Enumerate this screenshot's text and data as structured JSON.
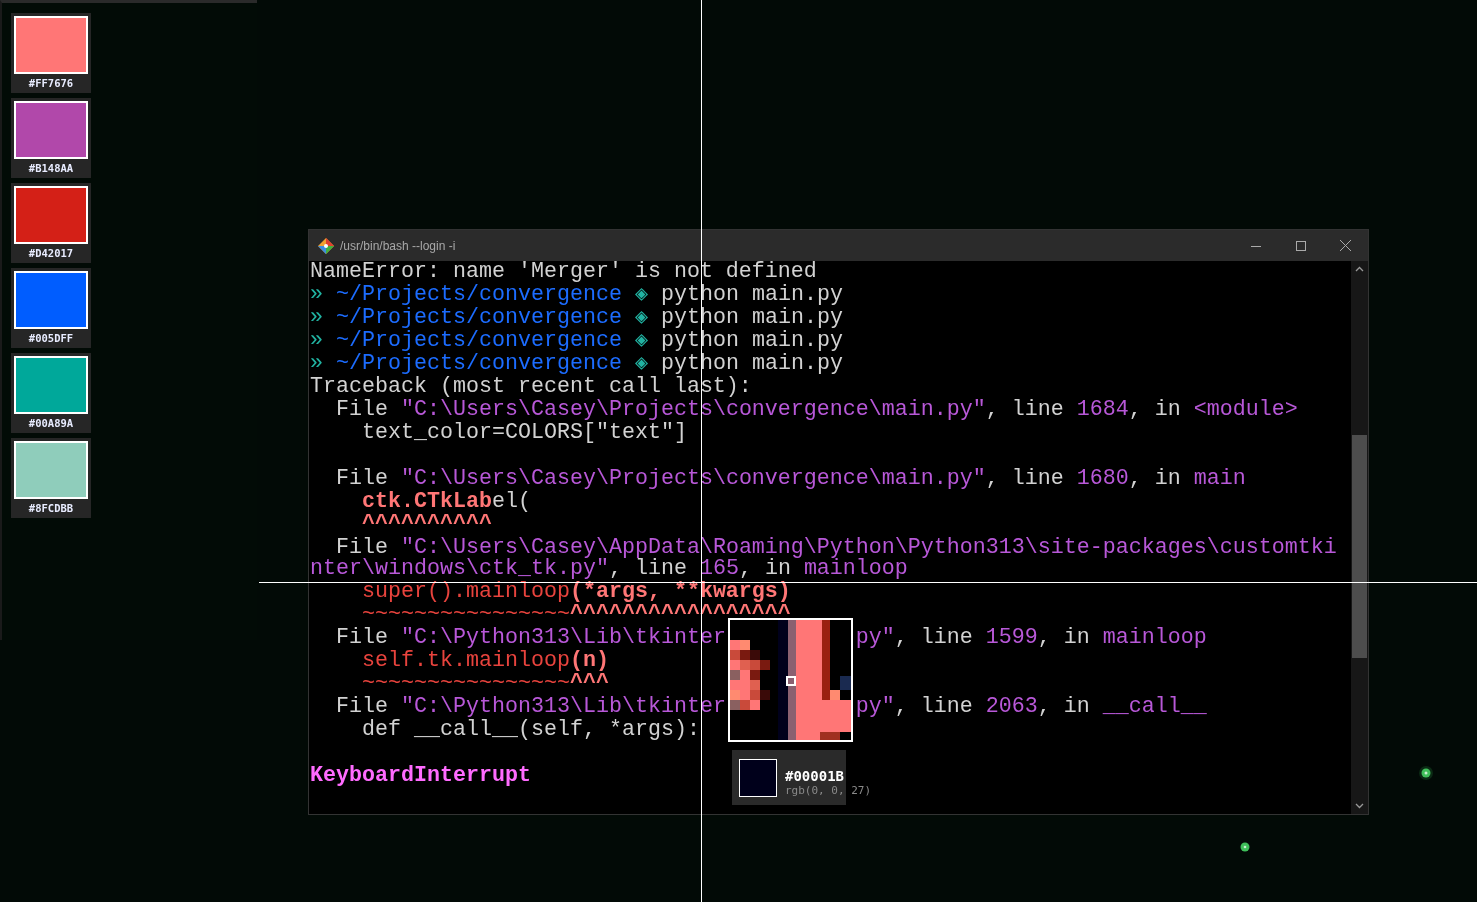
{
  "palette": {
    "swatches": [
      {
        "color": "#ff7676",
        "label": "#FF7676"
      },
      {
        "color": "#b148aa",
        "label": "#B148AA"
      },
      {
        "color": "#d42017",
        "label": "#D42017"
      },
      {
        "color": "#005dff",
        "label": "#005DFF"
      },
      {
        "color": "#00a89a",
        "label": "#00A89A"
      },
      {
        "color": "#8fcdbb",
        "label": "#8FCDBB"
      }
    ]
  },
  "terminal": {
    "title": "/usr/bin/bash --login -i",
    "lines": [
      {
        "kind": "text",
        "segments": [
          {
            "text": "NameError: name 'Merger' is not defined",
            "kind": "plain"
          }
        ]
      },
      {
        "kind": "text",
        "segments": [
          {
            "text": "» ",
            "kind": "prompt"
          },
          {
            "text": "~/Projects/convergence",
            "kind": "path"
          },
          {
            "text": " ◈ ",
            "kind": "prompt"
          },
          {
            "text": "python main.py",
            "kind": "plain"
          }
        ]
      },
      {
        "kind": "text",
        "segments": [
          {
            "text": "» ",
            "kind": "prompt"
          },
          {
            "text": "~/Projects/convergence",
            "kind": "path"
          },
          {
            "text": " ◈ ",
            "kind": "prompt"
          },
          {
            "text": "python main.py",
            "kind": "plain"
          }
        ]
      },
      {
        "kind": "text",
        "segments": [
          {
            "text": "» ",
            "kind": "prompt"
          },
          {
            "text": "~/Projects/convergence",
            "kind": "path"
          },
          {
            "text": " ◈ ",
            "kind": "prompt"
          },
          {
            "text": "python main.py",
            "kind": "plain"
          }
        ]
      },
      {
        "kind": "text",
        "segments": [
          {
            "text": "» ",
            "kind": "prompt"
          },
          {
            "text": "~/Projects/convergence",
            "kind": "path"
          },
          {
            "text": " ◈ ",
            "kind": "prompt"
          },
          {
            "text": "python main.py",
            "kind": "plain"
          }
        ]
      },
      {
        "kind": "text",
        "segments": [
          {
            "text": "Traceback (most recent call last):",
            "kind": "plain"
          }
        ]
      },
      {
        "kind": "text",
        "segments": [
          {
            "text": "  File ",
            "kind": "plain"
          },
          {
            "text": "\"C:\\Users\\Casey\\Projects\\convergence\\main.py\"",
            "kind": "string"
          },
          {
            "text": ", line ",
            "kind": "plain"
          },
          {
            "text": "1684",
            "kind": "string"
          },
          {
            "text": ", in ",
            "kind": "plain"
          },
          {
            "text": "<module>",
            "kind": "string"
          }
        ]
      },
      {
        "kind": "text",
        "segments": [
          {
            "text": "    text_color=COLORS[\"text\"]",
            "kind": "plain"
          }
        ]
      },
      {
        "kind": "blank"
      },
      {
        "kind": "text",
        "segments": [
          {
            "text": "  File ",
            "kind": "plain"
          },
          {
            "text": "\"C:\\Users\\Casey\\Projects\\convergence\\main.py\"",
            "kind": "string"
          },
          {
            "text": ", line ",
            "kind": "plain"
          },
          {
            "text": "1680",
            "kind": "string"
          },
          {
            "text": ", in ",
            "kind": "plain"
          },
          {
            "text": "main",
            "kind": "string"
          }
        ]
      },
      {
        "kind": "text",
        "segments": [
          {
            "text": "    ctk.CTkLab",
            "kind": "strong"
          },
          {
            "text": "el(",
            "kind": "plain"
          }
        ]
      },
      {
        "kind": "text",
        "segments": [
          {
            "text": "    ^^^^^^^^^^",
            "kind": "strong"
          }
        ]
      },
      {
        "kind": "text",
        "segments": [
          {
            "text": "  File ",
            "kind": "plain"
          },
          {
            "text": "\"C:\\Users\\Casey\\AppData\\Roaming\\Python\\Python313\\site-packages\\customtkinter\\windows\\ctk_tk.py\"",
            "kind": "string"
          },
          {
            "text": ", line ",
            "kind": "plain"
          },
          {
            "text": "165",
            "kind": "string"
          },
          {
            "text": ", in ",
            "kind": "plain"
          },
          {
            "text": "mainloop",
            "kind": "string"
          }
        ]
      },
      {
        "kind": "text",
        "segments": [
          {
            "text": "    super().mainloop",
            "kind": "code"
          },
          {
            "text": "(*args, **kwargs)",
            "kind": "strong"
          }
        ]
      },
      {
        "kind": "text",
        "segments": [
          {
            "text": "    ~~~~~~~~~~~~~~~~",
            "kind": "code"
          },
          {
            "text": "^^^^^^^^^^^^^^^^^",
            "kind": "strong"
          }
        ]
      },
      {
        "kind": "split",
        "segments": [
          {
            "text": "  File ",
            "kind": "plain"
          },
          {
            "text": "\"C:\\Python313\\Lib\\tkinter",
            "kind": "string"
          }
        ],
        "segments_after_magnifier": [
          {
            "text": "py\"",
            "kind": "string"
          },
          {
            "text": ", line ",
            "kind": "plain"
          },
          {
            "text": "1599",
            "kind": "string"
          },
          {
            "text": ", in ",
            "kind": "plain"
          },
          {
            "text": "mainloop",
            "kind": "string"
          }
        ]
      },
      {
        "kind": "text",
        "segments": [
          {
            "text": "    self.tk.mainloop",
            "kind": "code"
          },
          {
            "text": "(n)",
            "kind": "strong"
          }
        ]
      },
      {
        "kind": "text",
        "segments": [
          {
            "text": "    ~~~~~~~~~~~~~~~~",
            "kind": "code"
          },
          {
            "text": "^^^",
            "kind": "strong"
          }
        ]
      },
      {
        "kind": "split",
        "segments": [
          {
            "text": "  File ",
            "kind": "plain"
          },
          {
            "text": "\"C:\\Python313\\Lib\\tkinter",
            "kind": "string"
          }
        ],
        "segments_after_magnifier": [
          {
            "text": "py\"",
            "kind": "string"
          },
          {
            "text": ", line ",
            "kind": "plain"
          },
          {
            "text": "2063",
            "kind": "string"
          },
          {
            "text": ", in ",
            "kind": "plain"
          },
          {
            "text": "__call__",
            "kind": "string"
          }
        ]
      },
      {
        "kind": "text",
        "segments": [
          {
            "text": "    def __call__(self, *args):",
            "kind": "plain"
          }
        ]
      },
      {
        "kind": "blank"
      },
      {
        "kind": "text",
        "segments": [
          {
            "text": "KeyboardInterrupt",
            "kind": "error"
          }
        ]
      }
    ]
  },
  "picker": {
    "color": "#00001b",
    "hex": "#00001B",
    "rgb": "rgb(0, 0, 27)"
  }
}
